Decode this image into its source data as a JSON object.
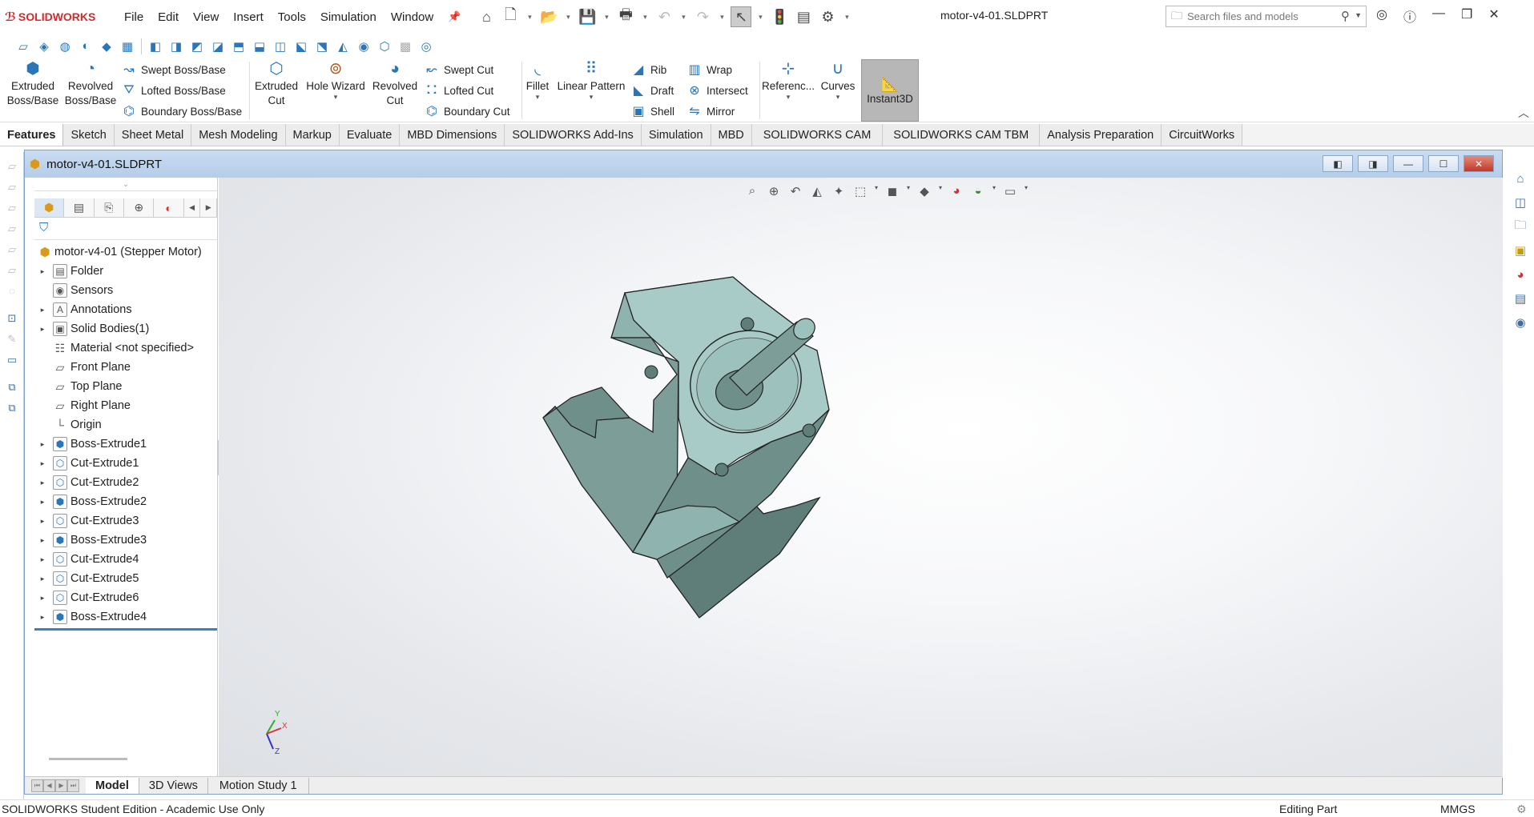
{
  "app": {
    "logo": "SOLIDWORKS",
    "doc_title": "motor-v4-01.SLDPRT"
  },
  "menu": [
    "File",
    "Edit",
    "View",
    "Insert",
    "Tools",
    "Simulation",
    "Window"
  ],
  "search": {
    "placeholder": "Search files and models"
  },
  "command_manager": {
    "extruded_boss": [
      "Extruded",
      "Boss/Base"
    ],
    "revolved_boss": [
      "Revolved",
      "Boss/Base"
    ],
    "swept_boss": "Swept Boss/Base",
    "lofted_boss": "Lofted Boss/Base",
    "boundary_boss": "Boundary Boss/Base",
    "extruded_cut": [
      "Extruded",
      "Cut"
    ],
    "hole_wizard": "Hole Wizard",
    "revolved_cut": [
      "Revolved",
      "Cut"
    ],
    "swept_cut": "Swept Cut",
    "lofted_cut": "Lofted Cut",
    "boundary_cut": "Boundary Cut",
    "fillet": "Fillet",
    "linear_pattern": "Linear Pattern",
    "rib": "Rib",
    "draft": "Draft",
    "shell": "Shell",
    "wrap": "Wrap",
    "intersect": "Intersect",
    "mirror": "Mirror",
    "reference": "Referenc...",
    "curves": "Curves",
    "instant3d": "Instant3D"
  },
  "tabs": [
    "Features",
    "Sketch",
    "Sheet Metal",
    "Mesh Modeling",
    "Markup",
    "Evaluate",
    "MBD Dimensions",
    "SOLIDWORKS Add-Ins",
    "Simulation",
    "MBD",
    "SOLIDWORKS CAM",
    "SOLIDWORKS CAM TBM",
    "Analysis Preparation",
    "CircuitWorks"
  ],
  "active_tab": "Features",
  "document_window": {
    "title": "motor-v4-01.SLDPRT"
  },
  "feature_tree": {
    "root": "motor-v4-01 (Stepper Motor)",
    "items": [
      {
        "label": "Folder",
        "expand": true,
        "icon": "folder-icon"
      },
      {
        "label": "Sensors",
        "expand": false,
        "icon": "sensor-icon"
      },
      {
        "label": "Annotations",
        "expand": true,
        "icon": "annotation-icon"
      },
      {
        "label": "Solid Bodies(1)",
        "expand": true,
        "icon": "solid-bodies-icon"
      },
      {
        "label": "Material <not specified>",
        "expand": false,
        "icon": "material-icon"
      },
      {
        "label": "Front Plane",
        "expand": false,
        "icon": "plane-icon"
      },
      {
        "label": "Top Plane",
        "expand": false,
        "icon": "plane-icon"
      },
      {
        "label": "Right Plane",
        "expand": false,
        "icon": "plane-icon"
      },
      {
        "label": "Origin",
        "expand": false,
        "icon": "origin-icon"
      },
      {
        "label": "Boss-Extrude1",
        "expand": true,
        "icon": "boss-extrude-icon"
      },
      {
        "label": "Cut-Extrude1",
        "expand": true,
        "icon": "cut-extrude-icon"
      },
      {
        "label": "Cut-Extrude2",
        "expand": true,
        "icon": "cut-extrude-icon"
      },
      {
        "label": "Boss-Extrude2",
        "expand": true,
        "icon": "boss-extrude-icon"
      },
      {
        "label": "Cut-Extrude3",
        "expand": true,
        "icon": "cut-extrude-icon"
      },
      {
        "label": "Boss-Extrude3",
        "expand": true,
        "icon": "boss-extrude-icon"
      },
      {
        "label": "Cut-Extrude4",
        "expand": true,
        "icon": "cut-extrude-icon"
      },
      {
        "label": "Cut-Extrude5",
        "expand": true,
        "icon": "cut-extrude-icon"
      },
      {
        "label": "Cut-Extrude6",
        "expand": true,
        "icon": "cut-extrude-icon"
      },
      {
        "label": "Boss-Extrude4",
        "expand": true,
        "icon": "boss-extrude-icon"
      }
    ]
  },
  "bottom_tabs": [
    "Model",
    "3D Views",
    "Motion Study 1"
  ],
  "triad": {
    "x": "X",
    "y": "Y",
    "z": "Z"
  },
  "status": {
    "left": "SOLIDWORKS Student Edition - Academic Use Only",
    "mode": "Editing Part",
    "units": "MMGS"
  },
  "colors": {
    "model_face_light": "#a8cbc7",
    "model_face_mid": "#7d9d99",
    "model_face_dark": "#5a7773",
    "accent": "#2a76b8",
    "doc_header": "#c9dcf2"
  }
}
